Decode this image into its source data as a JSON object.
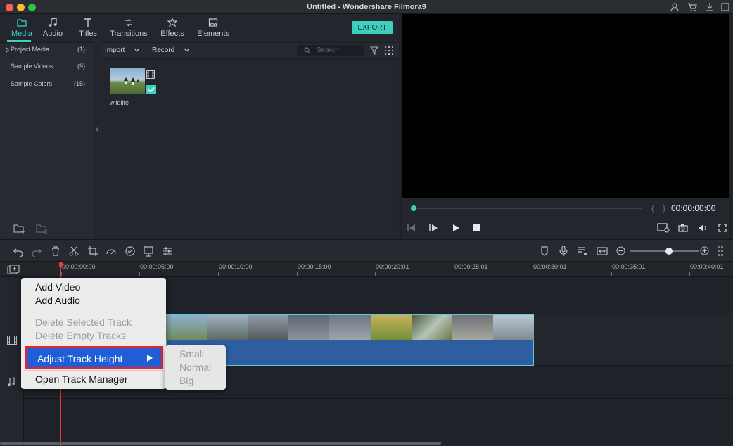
{
  "window": {
    "title": "Untitled - Wondershare Filmora9"
  },
  "tabs": [
    {
      "label": "Media",
      "icon": "folder-icon",
      "active": true
    },
    {
      "label": "Audio",
      "icon": "music-note-icon"
    },
    {
      "label": "Titles",
      "icon": "text-icon"
    },
    {
      "label": "Transitions",
      "icon": "transition-icon"
    },
    {
      "label": "Effects",
      "icon": "effects-icon"
    },
    {
      "label": "Elements",
      "icon": "image-icon"
    }
  ],
  "export_label": "EXPORT",
  "sidebar": {
    "items": [
      {
        "label": "Project Media",
        "count": "(1)"
      },
      {
        "label": "Sample Videos",
        "count": "(9)"
      },
      {
        "label": "Sample Colors",
        "count": "(15)"
      }
    ]
  },
  "media_toolbar": {
    "import_label": "Import",
    "record_label": "Record",
    "search_placeholder": "Search"
  },
  "media_items": [
    {
      "name": "wildlife"
    }
  ],
  "preview": {
    "timecode": "00:00:00:00",
    "bracket_in": "{",
    "bracket_out": "}"
  },
  "timeline": {
    "ruler_ticks": [
      "00:00:00:00",
      "00:00:05:00",
      "00:00:10:00",
      "00:00:15:00",
      "00:00:20:01",
      "00:00:25:01",
      "00:00:30:01",
      "00:00:35:01",
      "00:00:40:01"
    ]
  },
  "context_menu": {
    "items": [
      {
        "label": "Add Video",
        "enabled": true
      },
      {
        "label": "Add Audio",
        "enabled": true
      },
      {
        "label": "Delete Selected Track",
        "enabled": false
      },
      {
        "label": "Delete Empty Tracks",
        "enabled": false
      },
      {
        "label": "Adjust Track Height",
        "enabled": true,
        "highlighted": true
      },
      {
        "label": "Open Track Manager",
        "enabled": true
      }
    ],
    "submenu": [
      {
        "label": "Small",
        "enabled": false
      },
      {
        "label": "Normal",
        "enabled": false
      },
      {
        "label": "Big",
        "enabled": false
      }
    ]
  },
  "colors": {
    "accent": "#3fcfbd",
    "highlight_border": "#e8222c",
    "menu_selected": "#1f5ed6",
    "playhead": "#e23b3b",
    "clip_audio": "#2e5da0"
  }
}
